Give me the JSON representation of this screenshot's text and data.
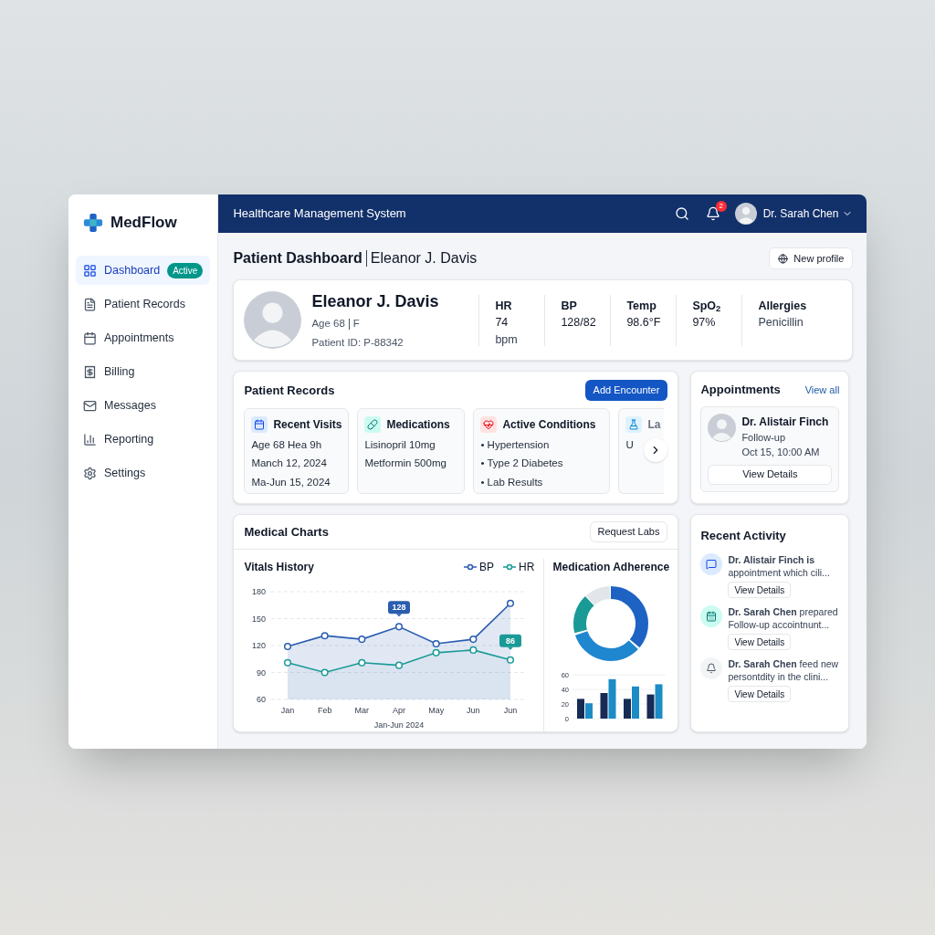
{
  "app": {
    "logo": "MedFlow",
    "header_title": "Healthcare Management System",
    "notification_count": "2",
    "user_name": "Dr. Sarah Chen"
  },
  "sidebar": {
    "items": [
      {
        "label": "Dashboard",
        "selected": true,
        "badge": "Active"
      },
      {
        "label": "Patient Records",
        "selected": false
      },
      {
        "label": "Appointments",
        "selected": false
      },
      {
        "label": "Billing",
        "selected": false
      },
      {
        "label": "Messages",
        "selected": false
      },
      {
        "label": "Reporting",
        "selected": false
      },
      {
        "label": "Settings",
        "selected": false
      }
    ]
  },
  "page_title": {
    "title": "Patient Dashboard",
    "subtitle": "Eleanor J. Davis",
    "button": "New profile"
  },
  "patient": {
    "name": "Eleanor J. Davis",
    "age": "Age 68",
    "sex": "F",
    "patient_id": "Patient ID: P-88342",
    "vitals": [
      {
        "label": "HR",
        "value": "74",
        "unit": "bpm"
      },
      {
        "label": "BP",
        "value": "128/82"
      },
      {
        "label": "Temp",
        "value": "98.6°F"
      },
      {
        "label": "SpO$_{2}$",
        "value": "97%"
      },
      {
        "label": "Allergies",
        "value": "Penicillin",
        "kind": "plain"
      }
    ]
  },
  "patient_records": {
    "title": "Patient Records",
    "button": "Add Encounter",
    "cards": [
      {
        "title": "Recent Visits",
        "lines": [
          "Age 68 Hea 9h",
          "Manch 12, 2024",
          "Ma-Jun 15, 2024"
        ]
      },
      {
        "title": "Medications",
        "lines": [
          "Lisinopril 10mg",
          "Metformin 500mg"
        ]
      },
      {
        "title": "Active Conditions",
        "lines": [
          "• Hypertension",
          "• Type 2 Diabetes",
          "• Lab Results"
        ]
      },
      {
        "title": "La",
        "lines": [
          "U"
        ]
      }
    ]
  },
  "appointments": {
    "title": "Appointments",
    "link": "View all",
    "items": [
      {
        "doctor": "Dr. Alistair Finch",
        "type": "Follow-up",
        "time": "Oct 15, 10:00 AM",
        "button": "View Details"
      }
    ]
  },
  "medical_charts": {
    "title": "Medical Charts",
    "button": "Request Labs",
    "vitals": {
      "chart_data": {
        "type": "area",
        "title": "Vitals History",
        "xlabel": "Jan-Jun 2024",
        "categories": [
          "Jan",
          "Feb",
          "Mar",
          "Apr",
          "May",
          "Jun",
          "Jun"
        ],
        "ylim": [
          60,
          180
        ],
        "yticks": [
          60,
          90,
          120,
          150,
          180
        ],
        "grid": true,
        "series": [
          {
            "name": "BP",
            "color": "#2a5db0",
            "marker": "o",
            "values": [
              119,
              131,
              127,
              141,
              122,
              127,
              167
            ]
          },
          {
            "name": "HR",
            "color": "#1a9a96",
            "marker": "o",
            "values": [
              101,
              90,
              101,
              98,
              112,
              115,
              104
            ]
          }
        ],
        "annotations": [
          {
            "x": "Apr",
            "y": 141,
            "text": "128"
          },
          "86"
        ]
      }
    },
    "adherence": {
      "title": "Medication Adherence",
      "chart_data": {
        "type": "bar",
        "ylim": [
          0,
          60
        ],
        "yticks": [
          0,
          20,
          40,
          60
        ],
        "series": [
          {
            "color": "#172b55",
            "values": [
              27,
              35,
              27,
              33
            ]
          },
          {
            "color": "#1c8cc6",
            "values": [
              21,
              54,
              44,
              47
            ]
          }
        ]
      }
    }
  },
  "recent_activity": {
    "title": "Recent Activity",
    "items": [
      {
        "text": "**Dr. Alistair Finch is** appointment which cili...",
        "button": "View Details"
      },
      {
        "text": "**Dr. Sarah Chen** prepared Follow-up accointnunt...",
        "button": "View Details"
      },
      {
        "text": "**Dr. Sarah Chen** feed new persontdity in the clini...",
        "button": "View Details"
      }
    ]
  }
}
